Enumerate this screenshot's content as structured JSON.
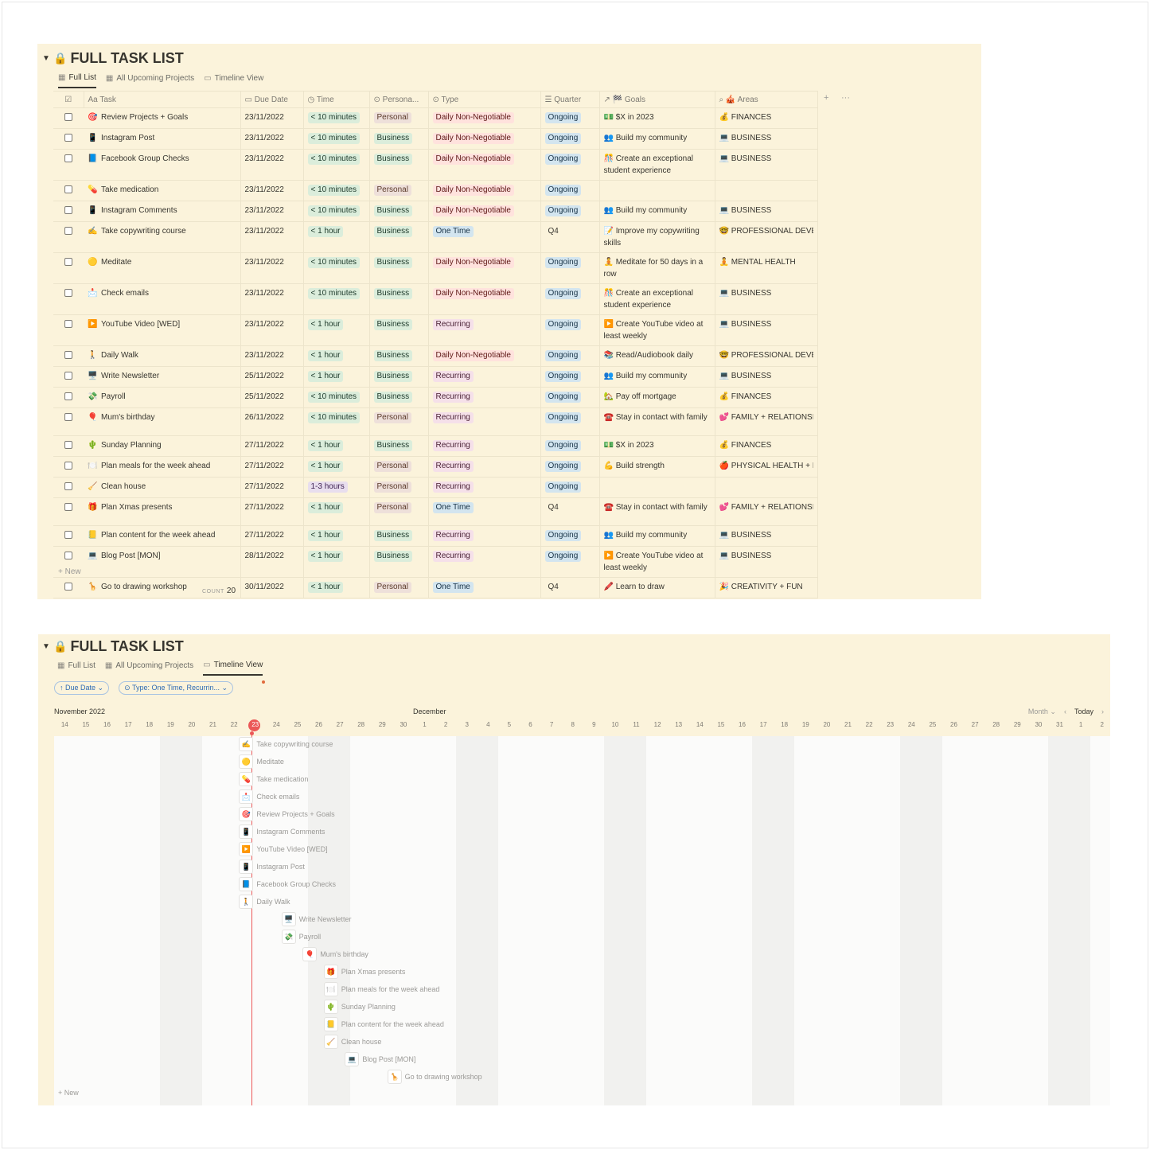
{
  "table_view": {
    "title": "FULL TASK LIST",
    "tabs": [
      {
        "label": "Full List",
        "active": true
      },
      {
        "label": "All Upcoming Projects",
        "active": false
      },
      {
        "label": "Timeline View",
        "active": false
      }
    ],
    "columns": {
      "task": "Task",
      "due_date": "Due Date",
      "time": "Time",
      "personal": "Persona...",
      "type": "Type",
      "quarter": "Quarter",
      "goals": "Goals",
      "areas": "Areas"
    },
    "rows": [
      {
        "emoji": "🎯",
        "task": "Review Projects + Goals",
        "due": "23/11/2022",
        "time": "< 10 minutes",
        "personal": "Personal",
        "type": "Daily Non-Negotiable",
        "quarter": "Ongoing",
        "goal_emoji": "💵",
        "goal": "$X in 2023",
        "area_emoji": "💰",
        "area": "FINANCES"
      },
      {
        "emoji": "📱",
        "task": "Instagram Post",
        "due": "23/11/2022",
        "time": "< 10 minutes",
        "personal": "Business",
        "type": "Daily Non-Negotiable",
        "quarter": "Ongoing",
        "goal_emoji": "👥",
        "goal": "Build my community",
        "area_emoji": "💻",
        "area": "BUSINESS"
      },
      {
        "emoji": "📘",
        "task": "Facebook Group Checks",
        "due": "23/11/2022",
        "time": "< 10 minutes",
        "personal": "Business",
        "type": "Daily Non-Negotiable",
        "quarter": "Ongoing",
        "goal_emoji": "🎊",
        "goal": "Create an exceptional student experience",
        "area_emoji": "💻",
        "area": "BUSINESS"
      },
      {
        "emoji": "💊",
        "task": "Take medication",
        "due": "23/11/2022",
        "time": "< 10 minutes",
        "personal": "Personal",
        "type": "Daily Non-Negotiable",
        "quarter": "Ongoing",
        "goal_emoji": "",
        "goal": "",
        "area_emoji": "",
        "area": ""
      },
      {
        "emoji": "📱",
        "task": "Instagram Comments",
        "due": "23/11/2022",
        "time": "< 10 minutes",
        "personal": "Business",
        "type": "Daily Non-Negotiable",
        "quarter": "Ongoing",
        "goal_emoji": "👥",
        "goal": "Build my community",
        "area_emoji": "💻",
        "area": "BUSINESS"
      },
      {
        "emoji": "✍️",
        "task": "Take copywriting course",
        "due": "23/11/2022",
        "time": "< 1 hour",
        "personal": "Business",
        "type": "One Time",
        "quarter": "Q4",
        "goal_emoji": "📝",
        "goal": "Improve my copywriting skills",
        "area_emoji": "🤓",
        "area": "PROFESSIONAL DEVE"
      },
      {
        "emoji": "🟡",
        "task": "Meditate",
        "due": "23/11/2022",
        "time": "< 10 minutes",
        "personal": "Business",
        "type": "Daily Non-Negotiable",
        "quarter": "Ongoing",
        "goal_emoji": "🧘",
        "goal": "Meditate for 50 days in a row",
        "area_emoji": "🧘",
        "area": "MENTAL HEALTH"
      },
      {
        "emoji": "📩",
        "task": "Check emails",
        "due": "23/11/2022",
        "time": "< 10 minutes",
        "personal": "Business",
        "type": "Daily Non-Negotiable",
        "quarter": "Ongoing",
        "goal_emoji": "🎊",
        "goal": "Create an exceptional student experience",
        "area_emoji": "💻",
        "area": "BUSINESS"
      },
      {
        "emoji": "▶️",
        "task": "YouTube Video [WED]",
        "due": "23/11/2022",
        "time": "< 1 hour",
        "personal": "Business",
        "type": "Recurring",
        "quarter": "Ongoing",
        "goal_emoji": "▶️",
        "goal": "Create YouTube video at least weekly",
        "area_emoji": "💻",
        "area": "BUSINESS"
      },
      {
        "emoji": "🚶",
        "task": "Daily Walk",
        "due": "23/11/2022",
        "time": "< 1 hour",
        "personal": "Business",
        "type": "Daily Non-Negotiable",
        "quarter": "Ongoing",
        "goal_emoji": "📚",
        "goal": "Read/Audiobook daily",
        "area_emoji": "🤓",
        "area": "PROFESSIONAL DEVE"
      },
      {
        "emoji": "🖥️",
        "task": "Write Newsletter",
        "due": "25/11/2022",
        "time": "< 1 hour",
        "personal": "Business",
        "type": "Recurring",
        "quarter": "Ongoing",
        "goal_emoji": "👥",
        "goal": "Build my community",
        "area_emoji": "💻",
        "area": "BUSINESS"
      },
      {
        "emoji": "💸",
        "task": "Payroll",
        "due": "25/11/2022",
        "time": "< 10 minutes",
        "personal": "Business",
        "type": "Recurring",
        "quarter": "Ongoing",
        "goal_emoji": "🏡",
        "goal": "Pay off mortgage",
        "area_emoji": "💰",
        "area": "FINANCES"
      },
      {
        "emoji": "🎈",
        "task": "Mum's birthday",
        "due": "26/11/2022",
        "time": "< 10 minutes",
        "personal": "Personal",
        "type": "Recurring",
        "quarter": "Ongoing",
        "goal_emoji": "☎️",
        "goal": "Stay in contact with family",
        "area_emoji": "💕",
        "area": "FAMILY + RELATIONSI"
      },
      {
        "emoji": "🌵",
        "task": "Sunday Planning",
        "due": "27/11/2022",
        "time": "< 1 hour",
        "personal": "Business",
        "type": "Recurring",
        "quarter": "Ongoing",
        "goal_emoji": "💵",
        "goal": "$X in 2023",
        "area_emoji": "💰",
        "area": "FINANCES"
      },
      {
        "emoji": "🍽️",
        "task": "Plan meals for the week ahead",
        "due": "27/11/2022",
        "time": "< 1 hour",
        "personal": "Personal",
        "type": "Recurring",
        "quarter": "Ongoing",
        "goal_emoji": "💪",
        "goal": "Build strength",
        "area_emoji": "🍎",
        "area": "PHYSICAL HEALTH + I"
      },
      {
        "emoji": "🧹",
        "task": "Clean house",
        "due": "27/11/2022",
        "time": "1-3 hours",
        "personal": "Personal",
        "type": "Recurring",
        "quarter": "Ongoing",
        "goal_emoji": "",
        "goal": "",
        "area_emoji": "",
        "area": ""
      },
      {
        "emoji": "🎁",
        "task": "Plan Xmas presents",
        "due": "27/11/2022",
        "time": "< 1 hour",
        "personal": "Personal",
        "type": "One Time",
        "quarter": "Q4",
        "goal_emoji": "☎️",
        "goal": "Stay in contact with family",
        "area_emoji": "💕",
        "area": "FAMILY + RELATIONSI"
      },
      {
        "emoji": "📒",
        "task": "Plan content for the week ahead",
        "due": "27/11/2022",
        "time": "< 1 hour",
        "personal": "Business",
        "type": "Recurring",
        "quarter": "Ongoing",
        "goal_emoji": "👥",
        "goal": "Build my community",
        "area_emoji": "💻",
        "area": "BUSINESS"
      },
      {
        "emoji": "💻",
        "task": "Blog Post [MON]",
        "due": "28/11/2022",
        "time": "< 1 hour",
        "personal": "Business",
        "type": "Recurring",
        "quarter": "Ongoing",
        "goal_emoji": "▶️",
        "goal": "Create YouTube video at least weekly",
        "area_emoji": "💻",
        "area": "BUSINESS"
      },
      {
        "emoji": "🦒",
        "task": "Go to drawing workshop",
        "due": "30/11/2022",
        "time": "< 1 hour",
        "personal": "Personal",
        "type": "One Time",
        "quarter": "Q4",
        "goal_emoji": "🖍️",
        "goal": "Learn to draw",
        "area_emoji": "🎉",
        "area": "CREATIVITY + FUN"
      }
    ],
    "new_label": "+ New",
    "count_label": "COUNT",
    "count_value": "20"
  },
  "timeline_view": {
    "title": "FULL TASK LIST",
    "tabs": [
      {
        "label": "Full List",
        "active": false
      },
      {
        "label": "All Upcoming Projects",
        "active": false
      },
      {
        "label": "Timeline View",
        "active": true
      }
    ],
    "filters": {
      "sort": "↑ Due Date ⌄",
      "type": "⊙ Type: One Time, Recurrin... ⌄"
    },
    "month_labels": [
      "November 2022",
      "December"
    ],
    "controls": {
      "scale": "Month ⌄",
      "prev": "‹",
      "today": "Today",
      "next": "›"
    },
    "days": [
      "14",
      "15",
      "16",
      "17",
      "18",
      "19",
      "20",
      "21",
      "22",
      "23",
      "24",
      "25",
      "26",
      "27",
      "28",
      "29",
      "30",
      "1",
      "2",
      "3",
      "4",
      "5",
      "6",
      "7",
      "8",
      "9",
      "10",
      "11",
      "12",
      "13",
      "14",
      "15",
      "16",
      "17",
      "18",
      "19",
      "20",
      "21",
      "22",
      "23",
      "24",
      "25",
      "26",
      "27",
      "28",
      "29",
      "30",
      "31",
      "1",
      "2"
    ],
    "items": [
      {
        "emoji": "✍️",
        "label": "Take copywriting course",
        "day": "23"
      },
      {
        "emoji": "🟡",
        "label": "Meditate",
        "day": "23"
      },
      {
        "emoji": "💊",
        "label": "Take medication",
        "day": "23"
      },
      {
        "emoji": "📩",
        "label": "Check emails",
        "day": "23"
      },
      {
        "emoji": "🎯",
        "label": "Review Projects + Goals",
        "day": "23"
      },
      {
        "emoji": "📱",
        "label": "Instagram Comments",
        "day": "23"
      },
      {
        "emoji": "▶️",
        "label": "YouTube Video [WED]",
        "day": "23"
      },
      {
        "emoji": "📱",
        "label": "Instagram Post",
        "day": "23"
      },
      {
        "emoji": "📘",
        "label": "Facebook Group Checks",
        "day": "23"
      },
      {
        "emoji": "🚶",
        "label": "Daily Walk",
        "day": "23"
      },
      {
        "emoji": "🖥️",
        "label": "Write Newsletter",
        "day": "25"
      },
      {
        "emoji": "💸",
        "label": "Payroll",
        "day": "25"
      },
      {
        "emoji": "🎈",
        "label": "Mum's birthday",
        "day": "26"
      },
      {
        "emoji": "🎁",
        "label": "Plan Xmas presents",
        "day": "27"
      },
      {
        "emoji": "🍽️",
        "label": "Plan meals for the week ahead",
        "day": "27"
      },
      {
        "emoji": "🌵",
        "label": "Sunday Planning",
        "day": "27"
      },
      {
        "emoji": "📒",
        "label": "Plan content for the week ahead",
        "day": "27"
      },
      {
        "emoji": "🧹",
        "label": "Clean house",
        "day": "27"
      },
      {
        "emoji": "💻",
        "label": "Blog Post [MON]",
        "day": "28"
      },
      {
        "emoji": "🦒",
        "label": "Go to drawing workshop",
        "day": "30"
      }
    ],
    "new_label": "+ New"
  }
}
